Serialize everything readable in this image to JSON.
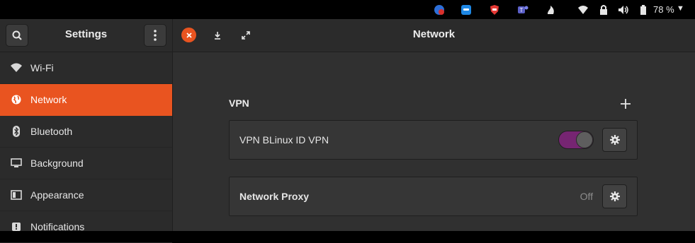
{
  "system_tray": {
    "battery_percent": "78 %",
    "icons": [
      "vpn-app-icon",
      "chat-app-icon",
      "shield-app-icon",
      "teams-app-icon",
      "flame-app-icon",
      "wifi-icon",
      "lock-icon",
      "volume-icon",
      "battery-icon"
    ]
  },
  "window": {
    "sidebar_title": "Settings",
    "page_title": "Network"
  },
  "sidebar": {
    "items": [
      {
        "label": "Wi-Fi",
        "icon": "wifi-icon"
      },
      {
        "label": "Network",
        "icon": "globe-icon"
      },
      {
        "label": "Bluetooth",
        "icon": "bluetooth-icon"
      },
      {
        "label": "Background",
        "icon": "display-icon"
      },
      {
        "label": "Appearance",
        "icon": "appearance-icon"
      },
      {
        "label": "Notifications",
        "icon": "notifications-icon"
      }
    ],
    "active_index": 1
  },
  "main": {
    "vpn_heading": "VPN",
    "vpn_connection": {
      "label": "VPN BLinux ID VPN",
      "enabled": true
    },
    "network_proxy": {
      "label": "Network Proxy",
      "status": "Off"
    }
  },
  "colors": {
    "accent": "#e95420",
    "toggle_on": "#762572",
    "background": "#303030",
    "sidebar": "#2b2b2b"
  }
}
